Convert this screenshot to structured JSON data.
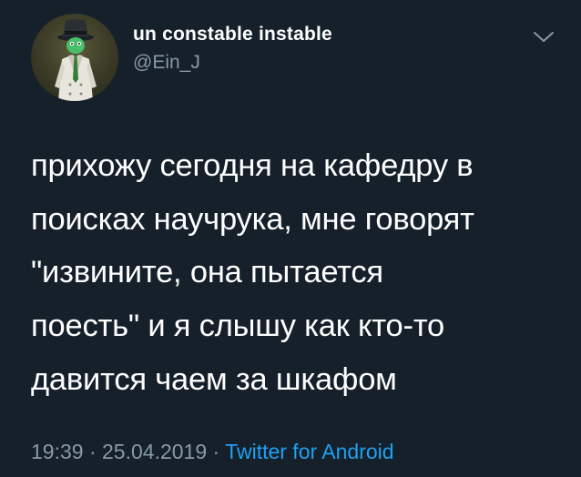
{
  "author": {
    "display_name": "un constable instable",
    "handle": "@Ein_J",
    "avatar_icon": "detective-avatar-icon"
  },
  "menu": {
    "icon": "chevron-down-icon"
  },
  "tweet": {
    "text": "прихожу сегодня на кафедру в\nпоисках научрука, мне говорят\n\"извините, она пытается\nпоесть\" и я слышу как кто-то\nдавится чаем за шкафом",
    "time": "19:39",
    "separator": "·",
    "date": "25.04.2019",
    "source": "Twitter for Android"
  },
  "colors": {
    "background": "#15202b",
    "secondary_text": "#8899a6",
    "link": "#1da1f2"
  }
}
